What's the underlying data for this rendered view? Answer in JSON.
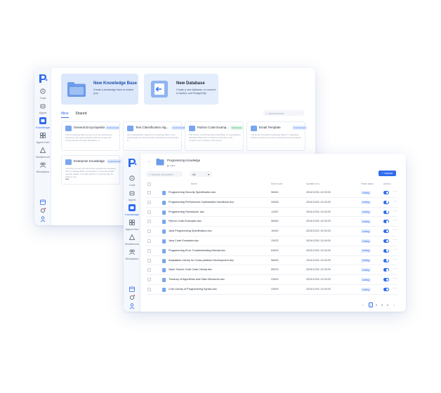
{
  "back_window": {
    "nav": [
      {
        "label": "Chat",
        "icon": "chat-icon"
      },
      {
        "label": "Agent",
        "icon": "agent-icon"
      },
      {
        "label": "Knowledge",
        "icon": "knowledge-icon",
        "active": true
      },
      {
        "label": "Agent Hub",
        "icon": "agent-hub-icon"
      },
      {
        "label": "Workbench",
        "icon": "workbench-icon"
      },
      {
        "label": "Workplace",
        "icon": "workplace-icon"
      }
    ],
    "banner_kb": {
      "title": "New Knowledge Base",
      "desc": "Create a knowledge base to embed your"
    },
    "banner_db": {
      "title": "New Database",
      "desc": "Create a new database, or connect to MySQL and PostgreSQL"
    },
    "tabs": [
      "Mine",
      "Shared"
    ],
    "search_placeholder": "Search here",
    "cards": [
      {
        "name": "General Encyclopedia ...",
        "tag": "Unstructured",
        "desc": "This Knowledge Base serves as a comprehensive repository that systematically archives all general entries across scientific disciplines, is"
      },
      {
        "name": "Text Classification Alg...",
        "tag": "Unstructured",
        "desc": "Text Classification Algorithm Knowledge Base: Core technologies for automatically categorizing textual data, is"
      },
      {
        "name": "Python Code Examp...",
        "tag": "Structured",
        "desc": "The Python Code Examples Data Base is a specialized database filled with a collection of Python code snippets and complete code blocks."
      },
      {
        "name": "Email Template",
        "tag": "Unstructured",
        "desc": "The Email Template Knowledge Base is a database housing a diverse set of pre-designed email templates."
      },
      {
        "name": "Enterprise Knowledge",
        "tag": "Unstructured",
        "desc": "Covering end-to-end enterprise operational processes, this Knowledge Base consolidates, is structured with specific details, from HR policies to engineering, for efficient use."
      }
    ]
  },
  "front_window": {
    "nav": [
      {
        "label": "Chat",
        "icon": "chat-icon"
      },
      {
        "label": "Agent",
        "icon": "agent-icon"
      },
      {
        "label": "Knowledge",
        "icon": "knowledge-icon",
        "active": true
      },
      {
        "label": "Agent Hub",
        "icon": "agent-hub-icon"
      },
      {
        "label": "Workbench",
        "icon": "workbench-icon"
      },
      {
        "label": "Workplace",
        "icon": "workplace-icon"
      }
    ],
    "title": "Programming Knowledge",
    "subtitle": "Label",
    "search_placeholder": "Search document",
    "filter_value": "All",
    "upload_label": "+ Upload",
    "columns": [
      "Name",
      "Word count",
      "Updated at",
      "Parse status",
      "Actions"
    ],
    "rows": [
      {
        "name": "Programming Security Specification.doc",
        "words": "56684",
        "updated": "2024/12/01 12:00:00",
        "status": "Uniting"
      },
      {
        "name": "Programming Performance Optimization Handbook.doc",
        "words": "34566",
        "updated": "2024/12/01 12:00:00",
        "status": "Uniting"
      },
      {
        "name": "Programming Framework .doc",
        "words": "12567",
        "updated": "2024/12/01 12:00:00",
        "status": "Uniting"
      },
      {
        "name": "Python Code Examples.doc",
        "words": "56684",
        "updated": "2024/12/01 12:00:00",
        "status": "Uniting"
      },
      {
        "name": "Java Programming Specification.doc",
        "words": "16462",
        "updated": "2024/12/01 12:00:00",
        "status": "Uniting"
      },
      {
        "name": "Java Code Examples.doc",
        "words": "13432",
        "updated": "2024/12/01 12:00:00",
        "status": "Uniting"
      },
      {
        "name": "Programming Error Troubleshooting Manual.doc",
        "words": "64632",
        "updated": "2024/12/01 12:00:00",
        "status": "Uniting"
      },
      {
        "name": "Adaptation Library for Cross-platform Development.doc",
        "words": "56684",
        "updated": "2024/12/01 12:00:00",
        "status": "Uniting"
      },
      {
        "name": "Open Source Code Case Library.doc",
        "words": "65032",
        "updated": "2024/12/01 12:00:00",
        "status": "Uniting"
      },
      {
        "name": "Treasury of Algorithms and Data Structures.doc",
        "words": "23649",
        "updated": "2024/12/01 12:00:00",
        "status": "Uniting"
      },
      {
        "name": "Core Library of Programming Syntax.doc",
        "words": "23649",
        "updated": "2024/12/01 12:00:00",
        "status": "Uniting"
      }
    ],
    "pages": [
      "1",
      "2",
      "3",
      "4"
    ],
    "current_page": "1"
  },
  "colors": {
    "accent": "#2f6bed",
    "banner_kb": "#dce8fb",
    "banner_db": "#e4eefb"
  }
}
